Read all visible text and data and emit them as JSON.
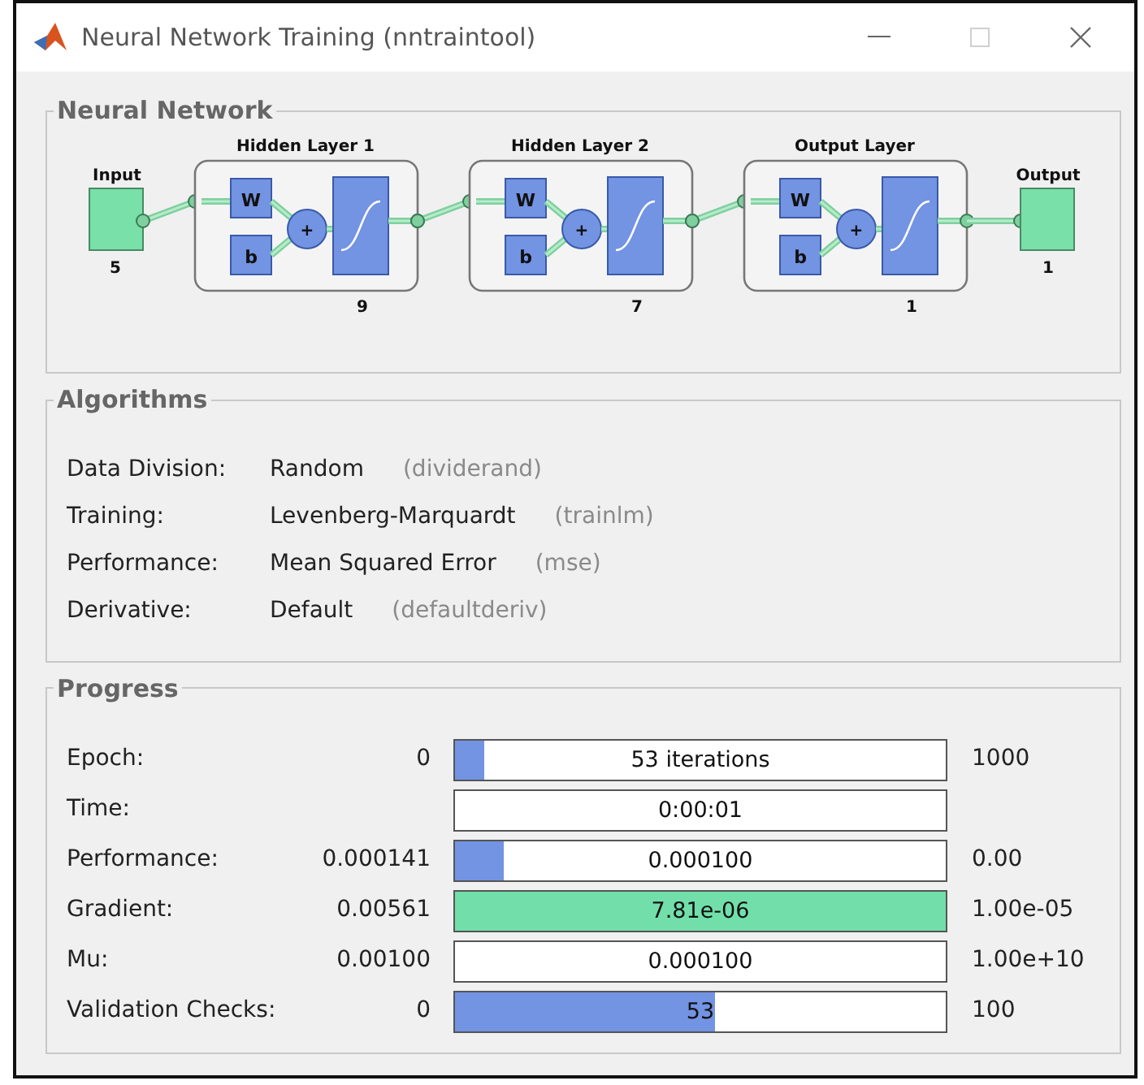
{
  "window": {
    "title": "Neural Network Training (nntraintool)",
    "maximize_enabled": false
  },
  "network": {
    "title": "Neural Network",
    "input": {
      "label": "Input",
      "size": "5"
    },
    "layers": [
      {
        "title": "Hidden Layer 1",
        "size": "9",
        "weight": "W",
        "bias": "b",
        "sum": "+"
      },
      {
        "title": "Hidden Layer 2",
        "size": "7",
        "weight": "W",
        "bias": "b",
        "sum": "+"
      },
      {
        "title": "Output Layer",
        "size": "1",
        "weight": "W",
        "bias": "b",
        "sum": "+"
      }
    ],
    "output": {
      "label": "Output",
      "size": "1"
    }
  },
  "algorithms": {
    "title": "Algorithms",
    "rows": [
      {
        "label": "Data Division:",
        "value": "Random",
        "function": "(dividerand)"
      },
      {
        "label": "Training:",
        "value": "Levenberg-Marquardt",
        "function": "(trainlm)"
      },
      {
        "label": "Performance:",
        "value": "Mean Squared Error",
        "function": "(mse)"
      },
      {
        "label": "Derivative:",
        "value": "Default",
        "function": "(defaultderiv)"
      }
    ]
  },
  "progress": {
    "title": "Progress",
    "rows": [
      {
        "label": "Epoch:",
        "start": "0",
        "reading": "53 iterations",
        "end": "1000",
        "level": 0.06,
        "goal_met": false
      },
      {
        "label": "Time:",
        "reading": "0:00:01",
        "goal_met": false
      },
      {
        "label": "Performance:",
        "start": "0.000141",
        "reading": "0.000100",
        "end": "0.00",
        "level": 0.1,
        "goal_met": false
      },
      {
        "label": "Gradient:",
        "start": "0.00561",
        "reading": "7.81e-06",
        "end": "1.00e-05",
        "level": 1,
        "goal_met": true
      },
      {
        "label": "Mu:",
        "start": "0.00100",
        "reading": "0.000100",
        "end": "1.00e+10",
        "goal_met": false
      },
      {
        "label": "Validation Checks:",
        "start": "0",
        "reading": "53",
        "end": "100",
        "level": 0.53,
        "goal_met": false
      }
    ]
  }
}
